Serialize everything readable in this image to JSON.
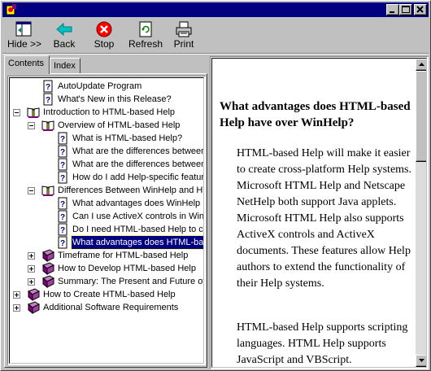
{
  "window": {
    "app_icon": "help-app-icon",
    "controls": [
      "minimize",
      "maximize",
      "close"
    ]
  },
  "toolbar": {
    "hide_label": "Hide >>",
    "back_label": "Back",
    "stop_label": "Stop",
    "refresh_label": "Refresh",
    "print_label": "Print"
  },
  "tabs": {
    "contents": "Contents",
    "index": "Index"
  },
  "tree": {
    "items": [
      {
        "label": "AutoUpdate Program",
        "icon": "page-icon"
      },
      {
        "label": "What's New in this Release?",
        "icon": "page-icon"
      },
      {
        "label": "Introduction to HTML-based Help",
        "icon": "open-book-icon"
      },
      {
        "label": "Overview of HTML-based Help",
        "icon": "open-book-icon"
      },
      {
        "label": "What is HTML-based Help?",
        "icon": "page-icon"
      },
      {
        "label": "What are the differences between",
        "icon": "page-icon"
      },
      {
        "label": "What are the differences between",
        "icon": "page-icon"
      },
      {
        "label": "How do I add Help-specific feature",
        "icon": "page-icon"
      },
      {
        "label": "Differences Between WinHelp and HT",
        "icon": "open-book-icon"
      },
      {
        "label": "What advantages does WinHelp h",
        "icon": "page-icon"
      },
      {
        "label": "Can I use ActiveX controls in Winh",
        "icon": "page-icon"
      },
      {
        "label": "Do I need HTML-based Help to cr",
        "icon": "page-icon"
      },
      {
        "label": "What advantages does HTML-bas",
        "icon": "page-icon",
        "selected": true
      },
      {
        "label": "Timeframe for HTML-based Help",
        "icon": "closed-book-icon"
      },
      {
        "label": "How to Develop HTML-based Help",
        "icon": "closed-book-icon"
      },
      {
        "label": "Summary:  The Present and Future of",
        "icon": "closed-book-icon"
      },
      {
        "label": "How to Create HTML-based Help",
        "icon": "closed-book-icon"
      },
      {
        "label": "Additional Software Requirements",
        "icon": "closed-book-icon"
      }
    ]
  },
  "content": {
    "heading": "What advantages does HTML-based Help have over WinHelp?",
    "paragraph1": "HTML-based Help will make it easier to create cross-platform Help systems. Microsoft HTML Help and Netscape NetHelp both support Java applets. Microsoft HTML Help also supports ActiveX controls and ActiveX documents. These features allow Help authors to extend the functionality of their Help systems.",
    "paragraph2": "HTML-based Help supports scripting languages. HTML Help supports JavaScript and VBScript."
  },
  "colors": {
    "titlebar": "#000080",
    "face": "#c0c0c0",
    "selection": "#000080",
    "book": "#800080",
    "stop": "#ff0000"
  }
}
